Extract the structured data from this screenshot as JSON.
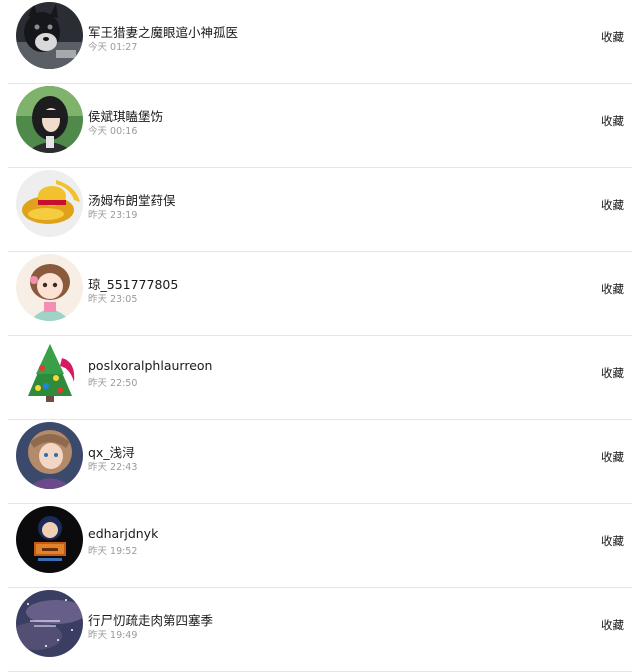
{
  "posts": [
    {
      "name": "军王猎妻之魔眼逭小神孤医",
      "time": "今天 01:27",
      "action": "收藏",
      "avatar_icon": "wolf-avatar"
    },
    {
      "name": "侯斌琪瞌堡饬",
      "time": "今天 00:16",
      "action": "收藏",
      "avatar_icon": "person-green-avatar"
    },
    {
      "name": "汤姆布朗堂荮俣",
      "time": "昨天 23:19",
      "action": "收藏",
      "avatar_icon": "yellow-hat-avatar"
    },
    {
      "name": "琼_551777805",
      "time": "昨天 23:05",
      "action": "收藏",
      "avatar_icon": "anime-girl-avatar"
    },
    {
      "name": "poslxoralphlaurreon",
      "time": "昨天 22:50",
      "action": "收藏",
      "avatar_icon": "christmas-tree-avatar"
    },
    {
      "name": "qx_浅浔",
      "time": "昨天 22:43",
      "action": "收藏",
      "avatar_icon": "anime-character-avatar"
    },
    {
      "name": "edharjdnyk",
      "time": "昨天 19:52",
      "action": "收藏",
      "avatar_icon": "detective-avatar"
    },
    {
      "name": "行尸忉疏走肉第四塞季",
      "time": "昨天 19:49",
      "action": "收藏",
      "avatar_icon": "night-sky-avatar"
    }
  ]
}
